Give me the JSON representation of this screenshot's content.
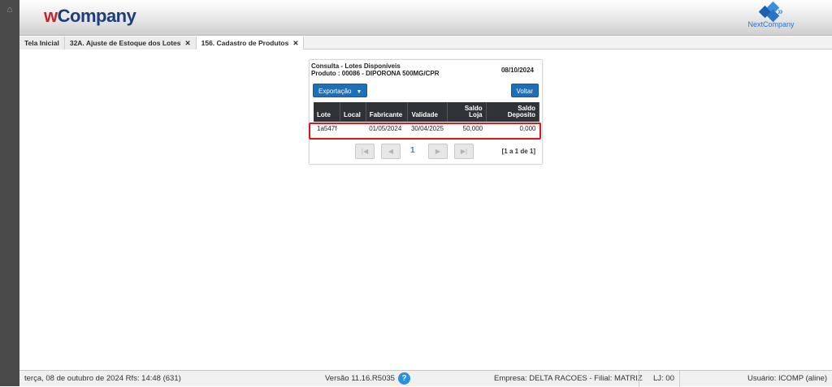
{
  "header": {
    "logo_w": "w",
    "logo_rest": "Company",
    "partner_logo": "NextCompany",
    "home_icon": "home-icon"
  },
  "tabs": [
    {
      "label": "Tela Inicial",
      "closable": false
    },
    {
      "label": "32A. Ajuste de Estoque dos Lotes",
      "closable": true
    },
    {
      "label": "156. Cadastro de Produtos",
      "closable": true
    }
  ],
  "panel": {
    "title": "Consulta - Lotes Disponíveis",
    "product": "Produto : 00086 - DIPORONA 500MG/CPR",
    "date": "08/10/2024",
    "export_label": "Exportação",
    "back_label": "Voltar"
  },
  "table": {
    "headers": [
      "Lote",
      "Local",
      "Fabricante",
      "Validade",
      "Saldo Loja",
      "Saldo Deposito"
    ],
    "rows": [
      [
        "1a547f",
        "",
        "01/05/2024",
        "30/04/2025",
        "50,000",
        "0,000"
      ]
    ]
  },
  "pager": {
    "page": "1",
    "info": "[1 a 1 de 1]"
  },
  "status": {
    "datetime": "terça, 08 de outubro de 2024  Rfs: 14:48 (631)",
    "version": "Versão 11.16.R5035",
    "help": "?",
    "empresa": "Empresa: DELTA RACOES - Filial: MATRIZ",
    "lj": "LJ: 00",
    "usuario": "Usuário: ICOMP (aline)"
  },
  "colors": {
    "accent": "#1d6fb8",
    "highlight": "#e0141e",
    "brand_red": "#c8242b",
    "brand_blue": "#1f3d7a"
  }
}
